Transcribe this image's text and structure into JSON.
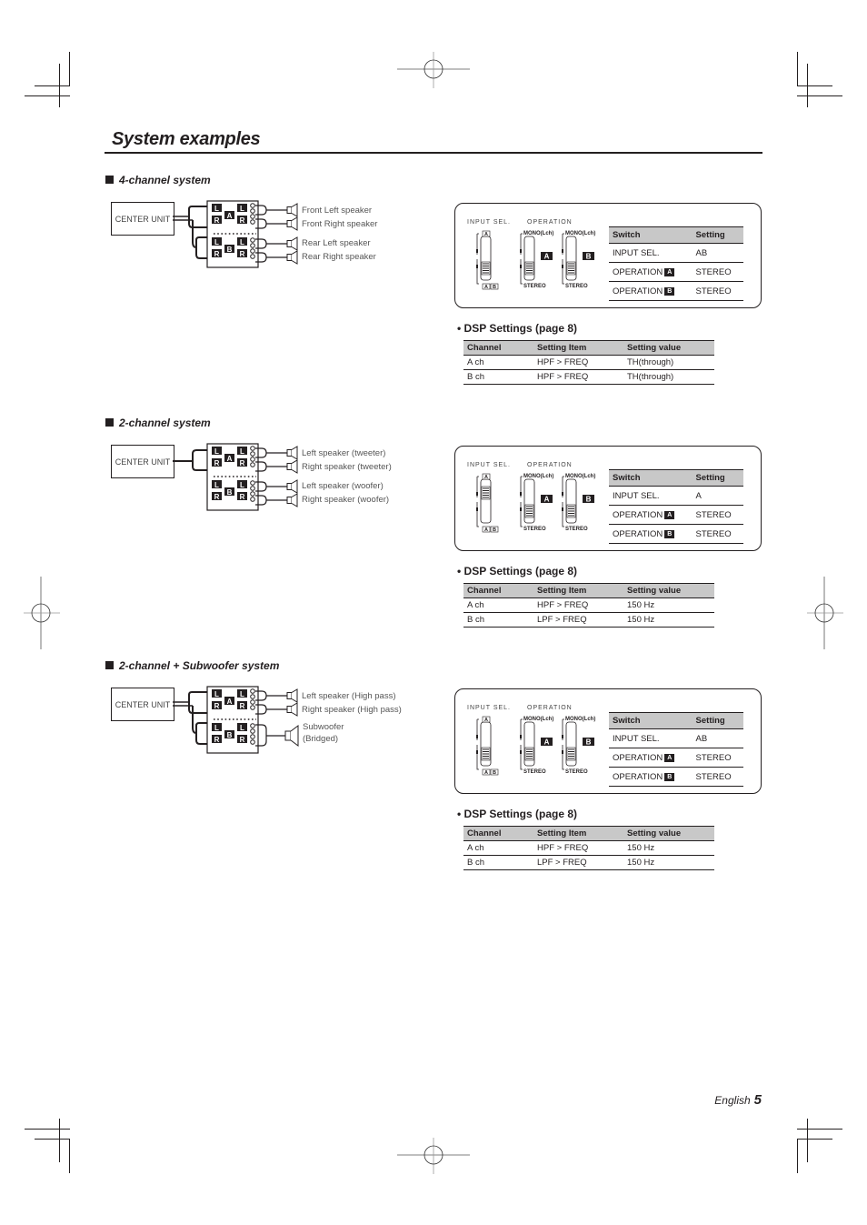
{
  "page_title": "System examples",
  "footer": {
    "language": "English",
    "page_number": "5"
  },
  "sections": [
    {
      "heading": "4-channel system",
      "center_unit": "CENTER UNIT",
      "amp_labels": {
        "upper": "A",
        "lower": "B",
        "left": "L",
        "right": "R"
      },
      "speakers": [
        "Front Left speaker",
        "Front Right speaker",
        "Rear Left speaker",
        "Rear Right speaker"
      ],
      "panel": {
        "input_sel_label": "INPUT SEL.",
        "operation_label": "OPERATION",
        "mono_label": "MONO(Lch)",
        "stereo_label": "STEREO",
        "input_sel_position": "AB",
        "switch_table": {
          "headers": [
            "Switch",
            "Setting"
          ],
          "rows": [
            {
              "switch": "INPUT SEL.",
              "badge": "",
              "setting": "AB"
            },
            {
              "switch": "OPERATION",
              "badge": "A",
              "setting": "STEREO"
            },
            {
              "switch": "OPERATION",
              "badge": "B",
              "setting": "STEREO"
            }
          ]
        }
      },
      "dsp": {
        "heading": "• DSP Settings (page 8)",
        "headers": [
          "Channel",
          "Setting Item",
          "Setting value"
        ],
        "rows": [
          [
            "A ch",
            "HPF > FREQ",
            "TH(through)"
          ],
          [
            "B ch",
            "HPF > FREQ",
            "TH(through)"
          ]
        ]
      }
    },
    {
      "heading": "2-channel system",
      "center_unit": "CENTER UNIT",
      "amp_labels": {
        "upper": "A",
        "lower": "B",
        "left": "L",
        "right": "R"
      },
      "speakers": [
        "Left speaker (tweeter)",
        "Right speaker (tweeter)",
        "Left speaker (woofer)",
        "Right speaker (woofer)"
      ],
      "panel": {
        "input_sel_label": "INPUT SEL.",
        "operation_label": "OPERATION",
        "mono_label": "MONO(Lch)",
        "stereo_label": "STEREO",
        "input_sel_position": "A",
        "switch_table": {
          "headers": [
            "Switch",
            "Setting"
          ],
          "rows": [
            {
              "switch": "INPUT SEL.",
              "badge": "",
              "setting": "A"
            },
            {
              "switch": "OPERATION",
              "badge": "A",
              "setting": "STEREO"
            },
            {
              "switch": "OPERATION",
              "badge": "B",
              "setting": "STEREO"
            }
          ]
        }
      },
      "dsp": {
        "heading": "• DSP Settings (page 8)",
        "headers": [
          "Channel",
          "Setting Item",
          "Setting value"
        ],
        "rows": [
          [
            "A ch",
            "HPF > FREQ",
            "150 Hz"
          ],
          [
            "B ch",
            "LPF > FREQ",
            "150 Hz"
          ]
        ]
      }
    },
    {
      "heading": "2-channel + Subwoofer system",
      "center_unit": "CENTER UNIT",
      "amp_labels": {
        "upper": "A",
        "lower": "B",
        "left": "L",
        "right": "R"
      },
      "speakers": [
        "Left speaker (High pass)",
        "Right speaker (High pass)",
        "Subwoofer",
        "(Bridged)"
      ],
      "panel": {
        "input_sel_label": "INPUT SEL.",
        "operation_label": "OPERATION",
        "mono_label": "MONO(Lch)",
        "stereo_label": "STEREO",
        "input_sel_position": "AB",
        "switch_table": {
          "headers": [
            "Switch",
            "Setting"
          ],
          "rows": [
            {
              "switch": "INPUT SEL.",
              "badge": "",
              "setting": "AB"
            },
            {
              "switch": "OPERATION",
              "badge": "A",
              "setting": "STEREO"
            },
            {
              "switch": "OPERATION",
              "badge": "B",
              "setting": "STEREO"
            }
          ]
        }
      },
      "dsp": {
        "heading": "• DSP Settings (page 8)",
        "headers": [
          "Channel",
          "Setting Item",
          "Setting value"
        ],
        "rows": [
          [
            "A ch",
            "HPF > FREQ",
            "150 Hz"
          ],
          [
            "B ch",
            "LPF > FREQ",
            "150 Hz"
          ]
        ]
      }
    }
  ]
}
